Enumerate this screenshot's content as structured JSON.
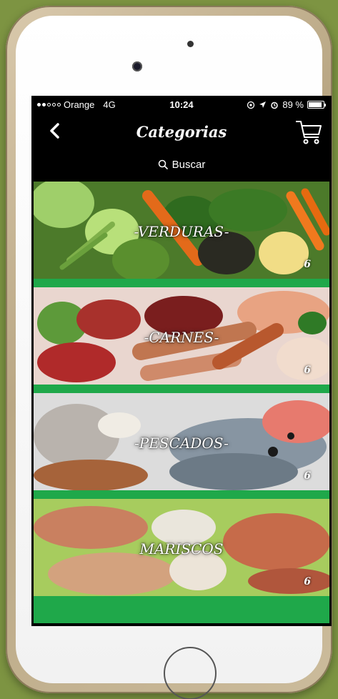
{
  "status_bar": {
    "carrier": "Orange",
    "network": "4G",
    "time": "10:24",
    "battery": "89 %",
    "battery_level": 0.89
  },
  "nav": {
    "title": "Categorias",
    "back_icon": "chevron-left-icon",
    "cart_icon": "shopping-cart-icon"
  },
  "search": {
    "label": "Buscar",
    "icon": "search-icon"
  },
  "categories": [
    {
      "name": "-VERDURAS-",
      "count": "6"
    },
    {
      "name": "-CARNES-",
      "count": "6"
    },
    {
      "name": "-PESCADOS-",
      "count": "6"
    },
    {
      "name": "MARISCOS",
      "count": "6"
    }
  ],
  "colors": {
    "accent_green": "#1fa84a",
    "nav_background": "#000000",
    "frame_gold": "#cbbb9b",
    "page_background": "#7d9442"
  }
}
